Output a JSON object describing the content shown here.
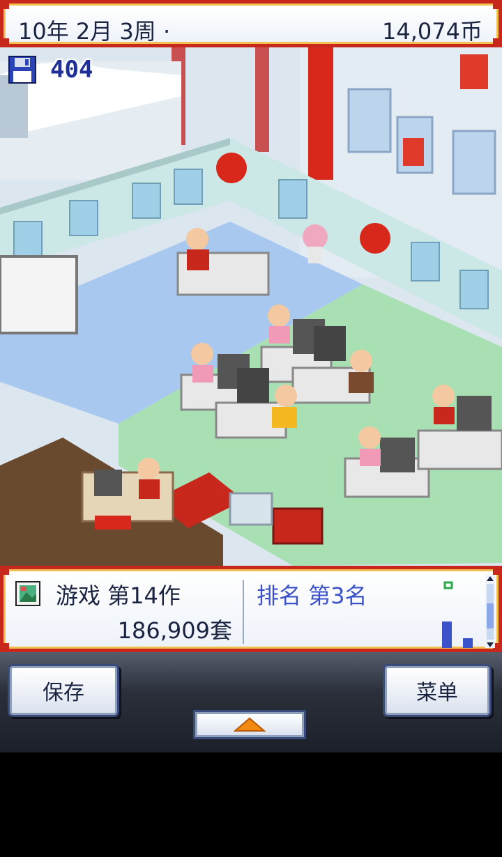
{
  "status_bar": {
    "date": "10年 2月 3周 ·",
    "money": "14,074币"
  },
  "save_counter": {
    "icon": "floppy-disk-icon",
    "value": "404"
  },
  "info_panel": {
    "game_icon": "game-cartridge-icon",
    "game_title": "游戏 第14作",
    "sales": "186,909套",
    "ranking": "排名 第3名"
  },
  "buttons": {
    "save": "保存",
    "menu": "菜单",
    "toggle_icon": "up-arrow-icon"
  },
  "colors": {
    "frame_red": "#c8281c",
    "frame_gold": "#f0c050",
    "rank_blue": "#3c52c8",
    "counter_blue": "#1f2f9a"
  }
}
